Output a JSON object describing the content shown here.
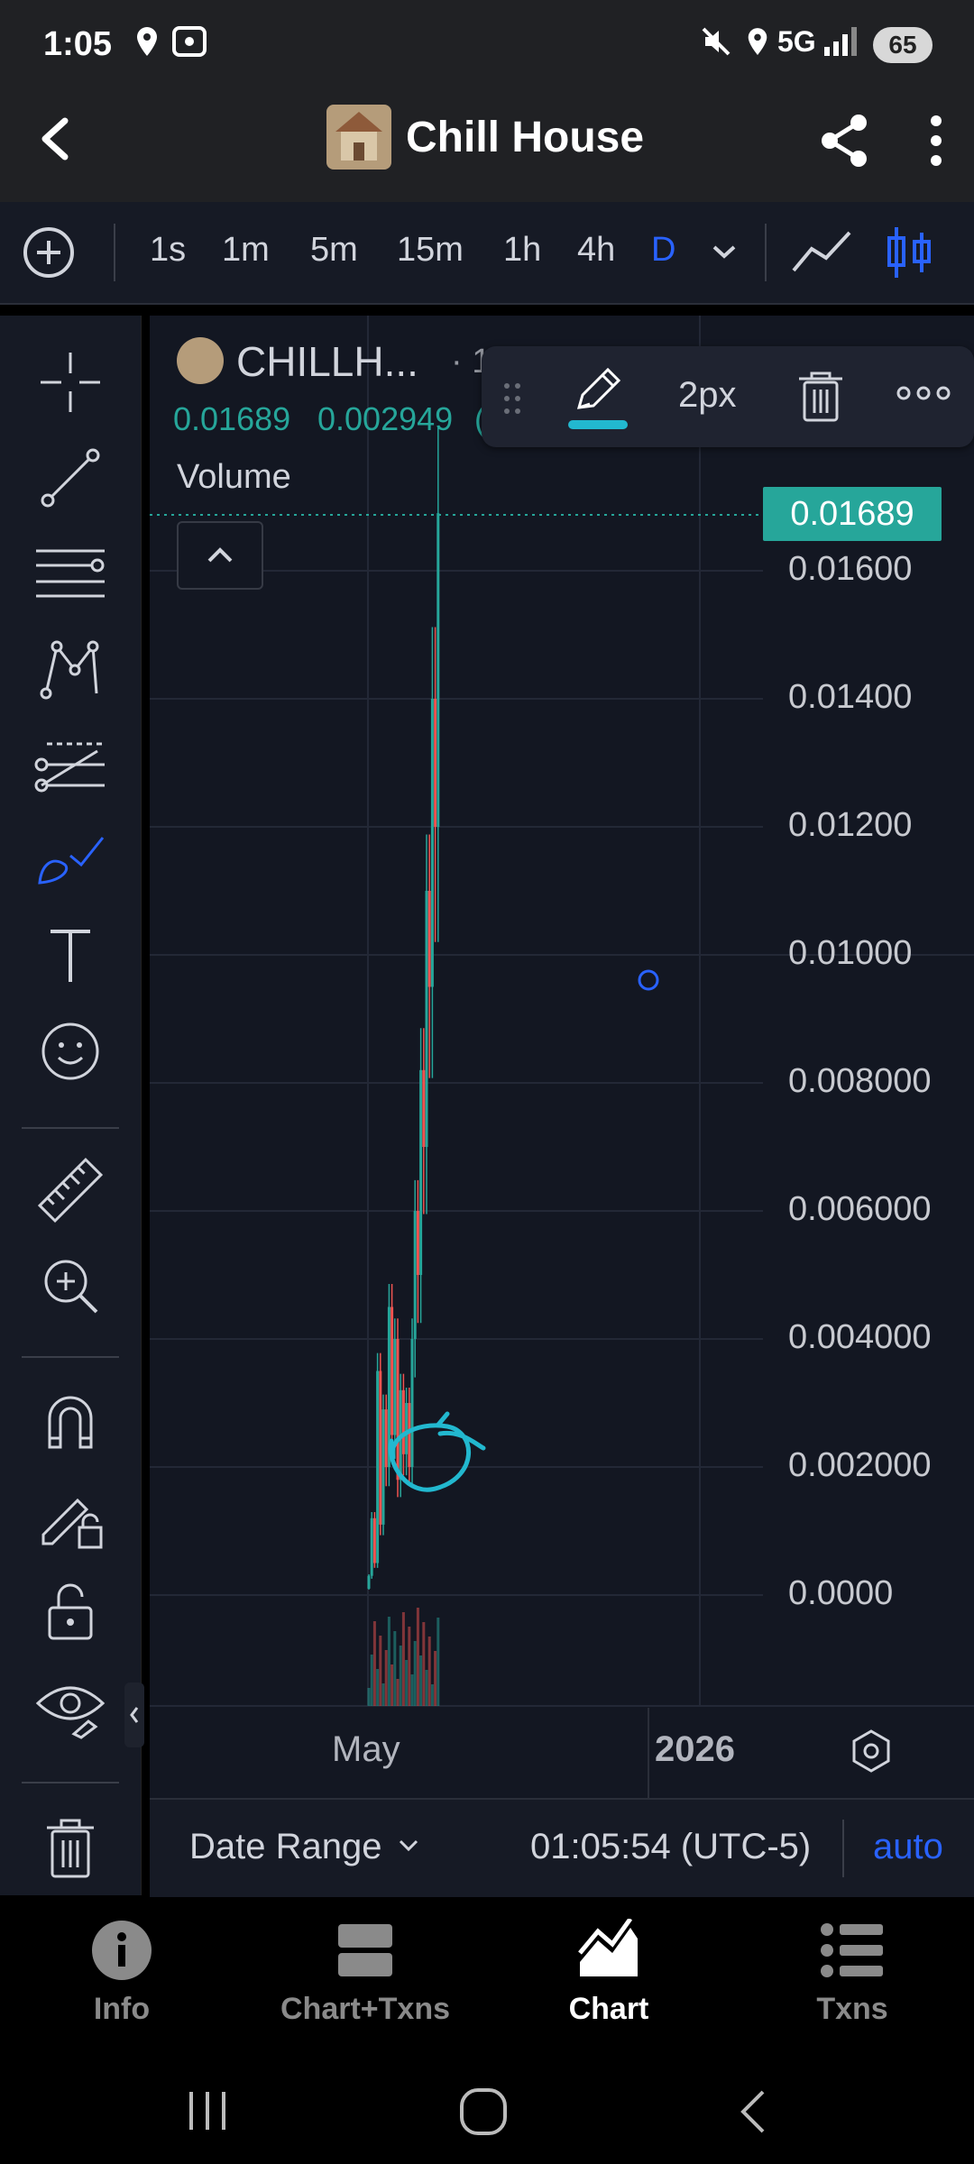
{
  "status_bar": {
    "time": "1:05",
    "network": "5G",
    "battery": "65"
  },
  "app_bar": {
    "title": "Chill House"
  },
  "timeframes": [
    "1s",
    "1m",
    "5m",
    "15m",
    "1h",
    "4h",
    "D"
  ],
  "active_timeframe": "D",
  "chart_header": {
    "symbol": "CHILLH...",
    "sep": "· 1",
    "value1": "0.01689",
    "value2": "0.002949",
    "value3": "(",
    "volume_label": "Volume"
  },
  "drawing_popup": {
    "width_label": "2px"
  },
  "current_price": "0.01689",
  "price_axis": [
    "0.01600",
    "0.01400",
    "0.01200",
    "0.01000",
    "0.008000",
    "0.006000",
    "0.004000",
    "0.002000",
    "0.0000"
  ],
  "time_axis": {
    "month": "May",
    "year": "2026"
  },
  "footer": {
    "date_range": "Date Range",
    "clock": "01:05:54 (UTC-5)",
    "auto": "auto"
  },
  "bottom_nav": [
    "Info",
    "Chart+Txns",
    "Chart",
    "Txns"
  ],
  "active_nav": "Chart",
  "colors": {
    "up": "#26a69a",
    "down": "#ef5350",
    "accent": "#2962ff",
    "drawing": "#22b8cf"
  }
}
